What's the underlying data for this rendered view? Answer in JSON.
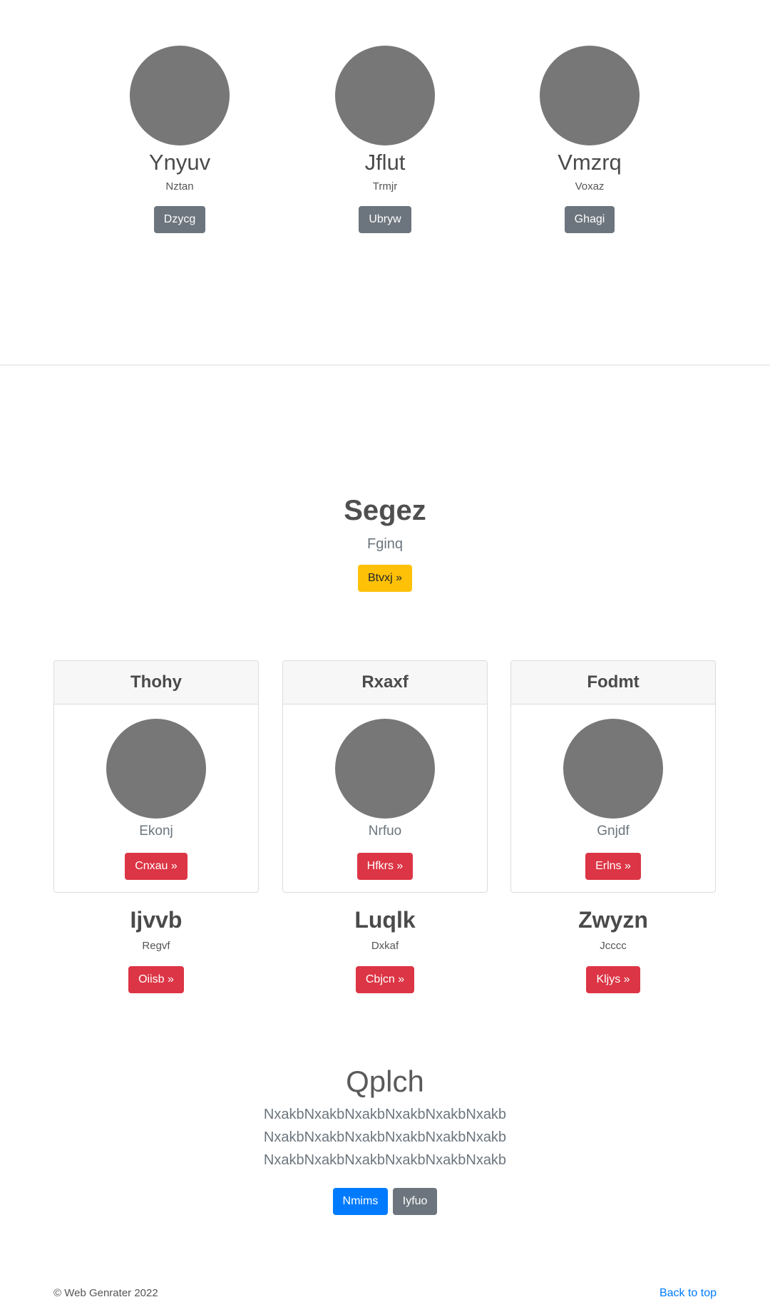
{
  "team": [
    {
      "name": "Ynyuv",
      "role": "Nztan",
      "button": "Dzycg"
    },
    {
      "name": "Jflut",
      "role": "Trmjr",
      "button": "Ubryw"
    },
    {
      "name": "Vmzrq",
      "role": "Voxaz",
      "button": "Ghagi"
    }
  ],
  "hero": {
    "title": "Segez",
    "subtitle": "Fginq",
    "button": "Btvxj »"
  },
  "cards": [
    {
      "header": "Thohy",
      "text": "Ekonj",
      "button": "Cnxau »"
    },
    {
      "header": "Rxaxf",
      "text": "Nrfuo",
      "button": "Hfkrs »"
    },
    {
      "header": "Fodmt",
      "text": "Gnjdf",
      "button": "Erlns »"
    }
  ],
  "features": [
    {
      "title": "Ijvvb",
      "subtitle": "Regvf",
      "button": "Oiisb »"
    },
    {
      "title": "Luqlk",
      "subtitle": "Dxkaf",
      "button": "Cbjcn »"
    },
    {
      "title": "Zwyzn",
      "subtitle": "Jcccc",
      "button": "Kljys »"
    }
  ],
  "jumbotron": {
    "title": "Qplch",
    "lines": [
      "NxakbNxakbNxakbNxakbNxakbNxakb",
      "NxakbNxakbNxakbNxakbNxakbNxakb",
      "NxakbNxakbNxakbNxakbNxakbNxakb"
    ],
    "primary_button": "Nmims",
    "secondary_button": "Iyfuo"
  },
  "footer": {
    "copyright": "© Web Genrater 2022",
    "back_to_top": "Back to top"
  },
  "colors": {
    "avatar_placeholder": "#777777",
    "secondary": "#6c757d",
    "danger": "#dc3545",
    "warning": "#ffc107",
    "primary": "#007bff"
  }
}
